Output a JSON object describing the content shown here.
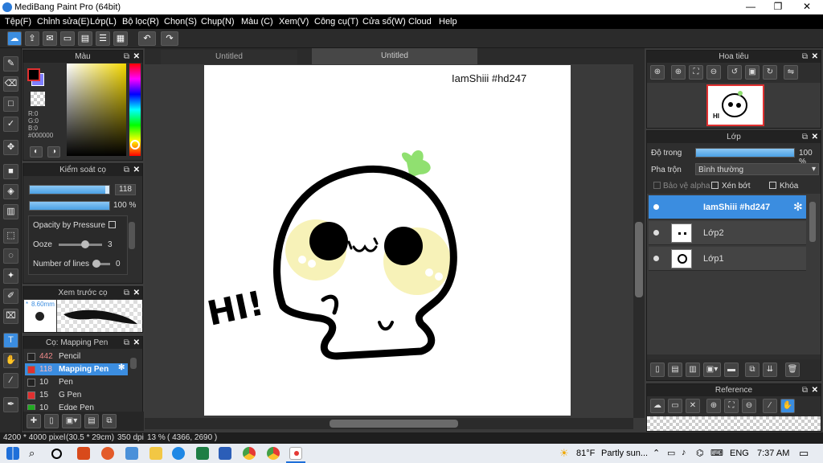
{
  "window": {
    "title": "MediBang Paint Pro (64bit)",
    "minimize": "—",
    "restore": "❐",
    "close": "✕"
  },
  "menu": [
    "Tệp(F)",
    "Chỉnh sửa(E)",
    "Lớp(L)",
    "Bộ lọc(R)",
    "Chọn(S)",
    "Chụp(N)",
    "Màu (C)",
    "Xem(V)",
    "Công cụ(T)",
    "Cửa sổ(W)",
    "Cloud",
    "Help"
  ],
  "tabs": [
    "Untitled",
    "Untitled"
  ],
  "color_panel": {
    "title": "Màu",
    "r": "R:0",
    "g": "G:0",
    "b": "B:0",
    "hex": "#000000",
    "primary": "#000000"
  },
  "brush_control": {
    "title": "Kiểm soát cọ",
    "size": "118",
    "opacity": "100 %",
    "opacity_pressure": "Opacity by Pressure",
    "ooze_label": "Ooze",
    "ooze_value": "3",
    "lines_label": "Number of lines",
    "lines_value": "0"
  },
  "brush_preview": {
    "title": "Xem trước cọ",
    "size": "8.60mm"
  },
  "brush_list": {
    "title": "Cọ: Mapping Pen",
    "items": [
      {
        "size": "442",
        "name": "Pencil",
        "color": "#222222",
        "selected": false
      },
      {
        "size": "118",
        "name": "Mapping Pen",
        "color": "#e03030",
        "selected": true
      },
      {
        "size": "10",
        "name": "Pen",
        "color": "#222222",
        "selected": false
      },
      {
        "size": "15",
        "name": "G Pen",
        "color": "#e03030",
        "selected": false
      },
      {
        "size": "10",
        "name": "Edge Pen",
        "color": "#22aa22",
        "selected": false
      }
    ]
  },
  "canvas": {
    "text": "IamShiii #hd247",
    "hi_text": "HI!"
  },
  "navigator": {
    "title": "Hoa tiêu"
  },
  "layers": {
    "title": "Lớp",
    "opacity_label": "Độ trong",
    "opacity_value": "100 %",
    "blend_label": "Pha trộn",
    "blend_value": "Bình thường",
    "protect_alpha": "Bảo vệ alpha",
    "clipping": "Xén bớt",
    "lock": "Khóa",
    "items": [
      {
        "name": "IamShiii #hd247",
        "selected": true
      },
      {
        "name": "Lớp2",
        "selected": false
      },
      {
        "name": "Lớp1",
        "selected": false
      }
    ]
  },
  "reference": {
    "title": "Reference"
  },
  "status": {
    "size": "4200 * 4000 pixel",
    "cm": "(30.5 * 29cm)",
    "dpi": "350 dpi",
    "zoom": "13 %",
    "coords": "( 4366, 2690 )"
  },
  "taskbar": {
    "temp": "81°F",
    "weather": "Partly sun...",
    "lang": "ENG",
    "time": "7:37 AM"
  }
}
